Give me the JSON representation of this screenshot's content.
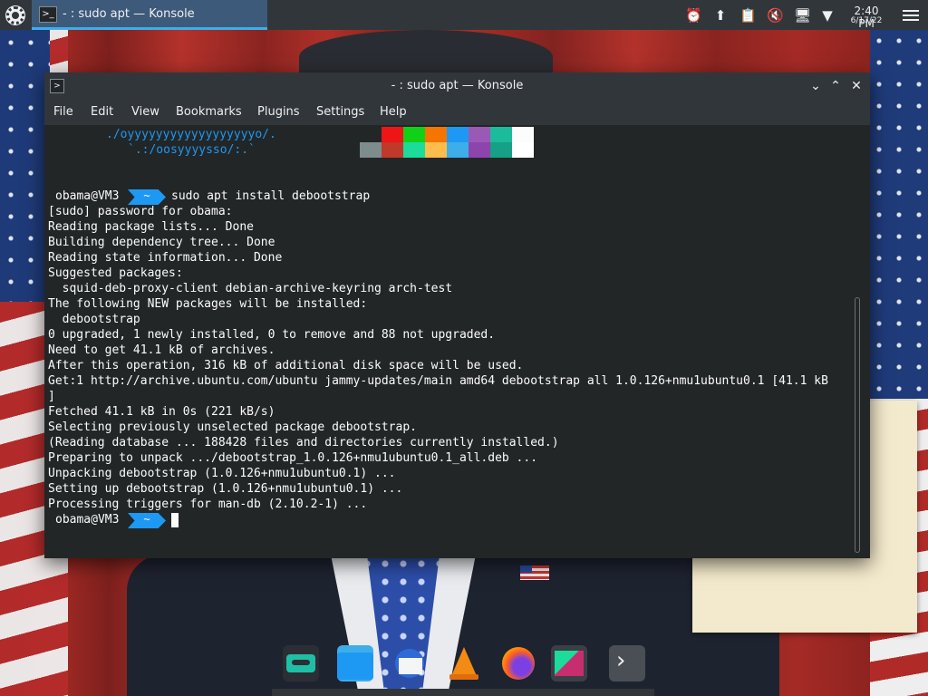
{
  "top_panel": {
    "task_title": "- : sudo apt — Konsole",
    "clock": {
      "time": "2:40 PM",
      "date": "6/17/22"
    },
    "tray_icons": [
      "notifications-icon",
      "updates-icon",
      "clipboard-icon",
      "volume-muted-icon",
      "network-icon",
      "expand-tray-icon"
    ]
  },
  "window": {
    "title": "- : sudo apt — Konsole",
    "menu": [
      "File",
      "Edit",
      "View",
      "Bookmarks",
      "Plugins",
      "Settings",
      "Help"
    ]
  },
  "terminal": {
    "ascii": [
      "./oyyyyyyyyyyyyyyyyyyo/.",
      "`.:/oosyyyysso/:.`"
    ],
    "color_swatches_top": [
      "#232627",
      "#ed1515",
      "#11d116",
      "#f67400",
      "#1d99f3",
      "#9b59b6",
      "#1abc9c",
      "#fcfcfc"
    ],
    "color_swatches_bottom": [
      "#7f8c8d",
      "#c0392b",
      "#1cdc9a",
      "#fdbc4b",
      "#3daee9",
      "#8e44ad",
      "#16a085",
      "#ffffff"
    ],
    "prompt_user": "obama@VM3",
    "prompt_dir": "~",
    "command": "sudo apt install debootstrap",
    "output": [
      "[sudo] password for obama:",
      "Reading package lists... Done",
      "Building dependency tree... Done",
      "Reading state information... Done",
      "Suggested packages:",
      "  squid-deb-proxy-client debian-archive-keyring arch-test",
      "The following NEW packages will be installed:",
      "  debootstrap",
      "0 upgraded, 1 newly installed, 0 to remove and 88 not upgraded.",
      "Need to get 41.1 kB of archives.",
      "After this operation, 316 kB of additional disk space will be used.",
      "Get:1 http://archive.ubuntu.com/ubuntu jammy-updates/main amd64 debootstrap all 1.0.126+nmu1ubuntu0.1 [41.1 kB",
      "]",
      "Fetched 41.1 kB in 0s (221 kB/s)",
      "Selecting previously unselected package debootstrap.",
      "(Reading database ... 188428 files and directories currently installed.)",
      "Preparing to unpack .../debootstrap_1.0.126+nmu1ubuntu0.1_all.deb ...",
      "Unpacking debootstrap (1.0.126+nmu1ubuntu0.1) ...",
      "Setting up debootstrap (1.0.126+nmu1ubuntu0.1) ...",
      "Processing triggers for man-db (2.10.2-1) ..."
    ]
  },
  "dock": {
    "icons": [
      "cassette-app-icon",
      "file-manager-icon",
      "mail-client-icon",
      "vlc-icon",
      "firefox-icon",
      "kdevelop-icon",
      "next-arrow-icon"
    ]
  }
}
